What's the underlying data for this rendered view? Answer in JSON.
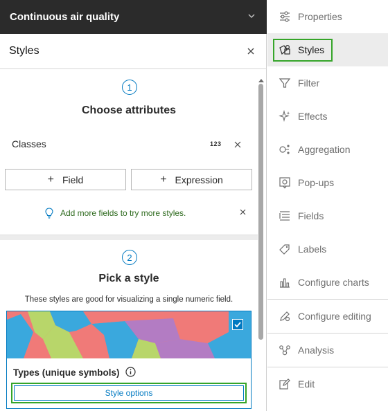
{
  "layer": {
    "title": "Continuous air quality",
    "chevron_icon": "chevron-down-icon"
  },
  "panel": {
    "title": "Styles",
    "close_icon": "close-icon"
  },
  "step1": {
    "number": "1",
    "title": "Choose attributes",
    "attribute": {
      "label": "Classes",
      "type_badge": "123"
    },
    "add_field_label": "Field",
    "add_expression_label": "Expression",
    "tip_text": "Add more fields to try more styles."
  },
  "step2": {
    "number": "2",
    "title": "Pick a style",
    "description": "These styles are good for visualizing a single numeric field.",
    "card": {
      "title": "Types (unique symbols)",
      "selected": true,
      "style_options_label": "Style options"
    }
  },
  "toolbar": {
    "items": [
      {
        "label": "Properties",
        "icon": "properties-icon"
      },
      {
        "label": "Styles",
        "icon": "styles-icon",
        "active": true
      },
      {
        "label": "Filter",
        "icon": "filter-icon"
      },
      {
        "label": "Effects",
        "icon": "effects-icon"
      },
      {
        "label": "Aggregation",
        "icon": "aggregation-icon"
      },
      {
        "label": "Pop-ups",
        "icon": "popups-icon"
      },
      {
        "label": "Fields",
        "icon": "fields-icon"
      },
      {
        "label": "Labels",
        "icon": "labels-icon"
      },
      {
        "label": "Configure charts",
        "icon": "charts-icon"
      },
      {
        "label": "Configure editing",
        "icon": "configure-editing-icon"
      },
      {
        "label": "Analysis",
        "icon": "analysis-icon"
      },
      {
        "label": "Edit",
        "icon": "edit-icon"
      }
    ]
  },
  "colors": {
    "header_bg": "#2b2b2b",
    "accent": "#0079c1",
    "highlight": "#35a529",
    "tip_text": "#2f6b1f",
    "map_palette": [
      "#f07a78",
      "#3aa8dd",
      "#b8d66a",
      "#b37cc3"
    ]
  }
}
